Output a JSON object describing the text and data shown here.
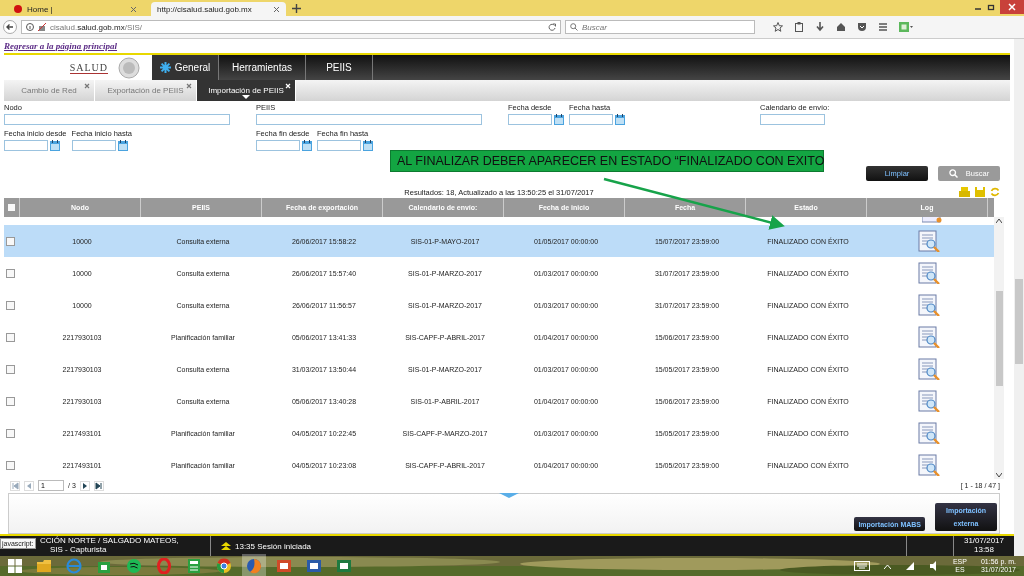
{
  "browser": {
    "tabs": [
      {
        "label": "Home |",
        "selected": false
      },
      {
        "label": "http://cisalud.salud.gob.mx",
        "selected": true
      }
    ],
    "url_host": "cisalud.",
    "url_domain": "salud.gob.mx",
    "url_path": "/SIS/",
    "search_placeholder": "Buscar"
  },
  "back_link": "Regresar a la página principal",
  "logo_text": "SALUD",
  "main_menu": [
    {
      "label": "General",
      "selected": true
    },
    {
      "label": "Herramientas",
      "selected": false
    },
    {
      "label": "PEIIS",
      "selected": false
    }
  ],
  "sub_tabs": [
    {
      "label": "Cambio de Red",
      "selected": false
    },
    {
      "label": "Exportación de PEIIS",
      "selected": false
    },
    {
      "label": "Importación de PEIIS",
      "selected": true
    }
  ],
  "filters": [
    {
      "label": "Nodo",
      "kind": "text"
    },
    {
      "label": "PEIIS",
      "kind": "text"
    },
    {
      "label": "Fecha desde",
      "kind": "date"
    },
    {
      "label": "Fecha hasta",
      "kind": "date"
    },
    {
      "label": "Calendario de envío:",
      "kind": "short"
    },
    {
      "label": "Fecha inicio desde",
      "kind": "date"
    },
    {
      "label": "Fecha inicio hasta",
      "kind": "date"
    },
    {
      "label": "Fecha fin desde",
      "kind": "date"
    },
    {
      "label": "Fecha fin hasta",
      "kind": "date"
    }
  ],
  "annotation": "AL FINALIZAR DEBER APARECER EN ESTADO “FINALIZADO CON EXITO",
  "buttons": [
    {
      "label": "Limpiar",
      "disabled": false
    },
    {
      "label": "Buscar",
      "disabled": true
    }
  ],
  "results_text": "Resultados: 18, Actualizado a las 13:50:25 el 31/07/2017",
  "table": {
    "select_all_checked": false,
    "columns": [
      "Nodo",
      "PEIIS",
      "Fecha de exportación",
      "Calendario de envío:",
      "Fecha de inicio",
      "Fecha",
      "Estado",
      "Log"
    ],
    "rows": [
      {
        "cells": [
          "10000",
          "Consulta externa",
          "26/06/2017 15:58:22",
          "SIS-01-P-MAYO-2017",
          "01/05/2017 00:00:00",
          "15/07/2017 23:59:00",
          "FINALIZADO CON ÉXITO"
        ],
        "selected": true,
        "checked": false
      },
      {
        "cells": [
          "10000",
          "Consulta externa",
          "26/06/2017 15:57:40",
          "SIS-01-P-MARZO-2017",
          "01/03/2017 00:00:00",
          "31/07/2017 23:59:00",
          "FINALIZADO CON ÉXITO"
        ],
        "selected": false,
        "checked": false
      },
      {
        "cells": [
          "10000",
          "Consulta externa",
          "26/06/2017 11:56:57",
          "SIS-01-P-MARZO-2017",
          "01/03/2017 00:00:00",
          "31/07/2017 23:59:00",
          "FINALIZADO CON ÉXITO"
        ],
        "selected": false,
        "checked": false
      },
      {
        "cells": [
          "2217930103",
          "Planificación familiar",
          "05/06/2017 13:41:33",
          "SIS-CAPF-P-ABRIL-2017",
          "01/04/2017 00:00:00",
          "15/06/2017 23:59:00",
          "FINALIZADO CON ÉXITO"
        ],
        "selected": false,
        "checked": false
      },
      {
        "cells": [
          "2217930103",
          "Consulta externa",
          "31/03/2017 13:50:44",
          "SIS-01-P-MARZO-2017",
          "01/03/2017 00:00:00",
          "15/05/2017 23:59:00",
          "FINALIZADO CON ÉXITO"
        ],
        "selected": false,
        "checked": false
      },
      {
        "cells": [
          "2217930103",
          "Consulta externa",
          "05/06/2017 13:40:28",
          "SIS-01-P-ABRIL-2017",
          "01/04/2017 00:00:00",
          "15/06/2017 23:59:00",
          "FINALIZADO CON ÉXITO"
        ],
        "selected": false,
        "checked": false
      },
      {
        "cells": [
          "2217493101",
          "Planificación familiar",
          "04/05/2017 10:22:45",
          "SIS-CAPF-P-MARZO-2017",
          "01/03/2017 00:00:00",
          "15/05/2017 23:59:00",
          "FINALIZADO CON ÉXITO"
        ],
        "selected": false,
        "checked": false
      },
      {
        "cells": [
          "2217493101",
          "Planificación familiar",
          "04/05/2017 10:23:08",
          "SIS-CAPF-P-ABRIL-2017",
          "01/04/2017 00:00:00",
          "15/05/2017 23:59:00",
          "FINALIZADO CON ÉXITO"
        ],
        "selected": false,
        "checked": false
      }
    ]
  },
  "pager": {
    "page": "1",
    "pages": "/ 3",
    "range": "[ 1 - 18 / 47 ]"
  },
  "panel_buttons": [
    "Importación MABS",
    "Importación externa"
  ],
  "footer": {
    "tooltip": "javascript:",
    "user_line1": "CCIÓN NORTE / SALGADO MATEOS,",
    "user_line2": "SIS - Capturista",
    "session": "13:35 Sesión iniciada",
    "date": "31/07/2017",
    "time": "13:58"
  },
  "taskbar": {
    "lang": "ESP",
    "lang2": "ES",
    "time": "01:56 p. m.",
    "date": "31/07/2017"
  }
}
